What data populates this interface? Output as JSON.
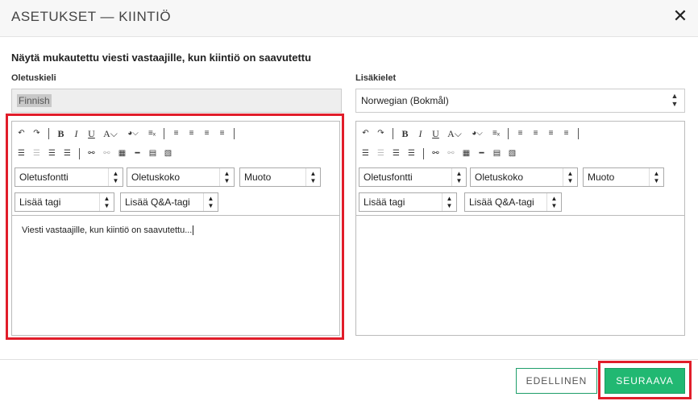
{
  "dialog": {
    "title": "ASETUKSET — KIINTIÖ",
    "close_glyph": "✕"
  },
  "section": {
    "heading": "Näytä mukautettu viesti vastaajille, kun kiintiö on saavutettu"
  },
  "default_language": {
    "label": "Oletuskieli",
    "value": "Finnish"
  },
  "additional_languages": {
    "label": "Lisäkielet",
    "value": "Norwegian (Bokmål)"
  },
  "toolbar": {
    "row1": [
      "↶",
      "↷",
      "B",
      "I",
      "U",
      "A⌵",
      "◕⌵",
      "≡ₓ",
      "≡",
      "≡",
      "≡",
      "≡"
    ],
    "row2": [
      "☰",
      "☰",
      "☰",
      "☰",
      "⚯",
      "⚯",
      "▦",
      "━",
      "▤",
      "▧"
    ]
  },
  "dropdowns": {
    "font": "Oletusfontti",
    "size": "Oletuskoko",
    "format": "Muoto",
    "tag": "Lisää tagi",
    "qa_tag": "Lisää Q&A-tagi"
  },
  "left_editor": {
    "content": "Viesti vastaajille, kun kiintiö on saavutettu..."
  },
  "right_editor": {
    "content": ""
  },
  "footer": {
    "prev_label": "EDELLINEN",
    "next_label": "SEURAAVA"
  },
  "colors": {
    "accent_green": "#21b872",
    "highlight_red": "#e11d2a"
  }
}
